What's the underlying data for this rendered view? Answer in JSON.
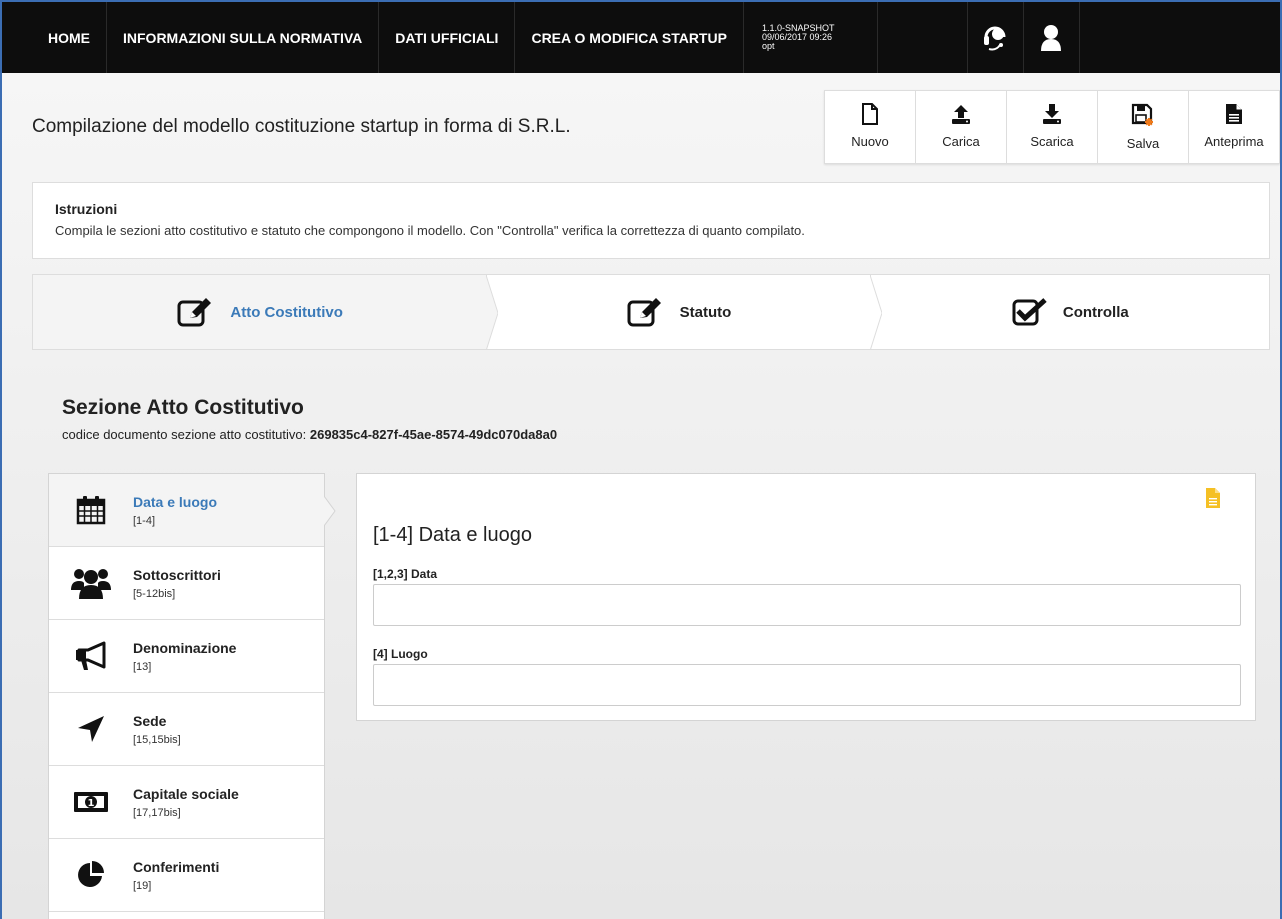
{
  "nav": {
    "items": [
      "HOME",
      "INFORMAZIONI SULLA NORMATIVA",
      "DATI UFFICIALI",
      "CREA O MODIFICA STARTUP"
    ],
    "version": [
      "1.1.0-SNAPSHOT",
      "09/06/2017 09:26",
      "opt"
    ]
  },
  "header": {
    "title": "Compilazione del modello costituzione startup in forma di S.R.L."
  },
  "toolbar": {
    "buttons": [
      {
        "label": "Nuovo",
        "icon": "new-file-icon"
      },
      {
        "label": "Carica",
        "icon": "upload-icon"
      },
      {
        "label": "Scarica",
        "icon": "download-icon"
      },
      {
        "label": "Salva",
        "icon": "save-icon"
      },
      {
        "label": "Anteprima",
        "icon": "preview-icon"
      }
    ]
  },
  "instructions": {
    "heading": "Istruzioni",
    "text": "Compila le sezioni atto costitutivo e statuto che compongono il modello. Con \"Controlla\" verifica la correttezza di quanto compilato."
  },
  "steps": [
    {
      "label": "Atto Costitutivo",
      "icon": "edit-icon",
      "active": true
    },
    {
      "label": "Statuto",
      "icon": "edit-icon",
      "active": false
    },
    {
      "label": "Controlla",
      "icon": "checkbox-icon",
      "active": false
    }
  ],
  "section": {
    "title": "Sezione Atto Costitutivo",
    "code_label": "codice documento sezione atto costitutivo:",
    "code_value": "269835c4-827f-45ae-8574-49dc070da8a0"
  },
  "sidemenu": [
    {
      "label": "Data e luogo",
      "ref": "[1-4]",
      "icon": "calendar-icon",
      "active": true
    },
    {
      "label": "Sottoscrittori",
      "ref": "[5-12bis]",
      "icon": "users-icon",
      "active": false
    },
    {
      "label": "Denominazione",
      "ref": "[13]",
      "icon": "megaphone-icon",
      "active": false
    },
    {
      "label": "Sede",
      "ref": "[15,15bis]",
      "icon": "location-arrow-icon",
      "active": false
    },
    {
      "label": "Capitale sociale",
      "ref": "[17,17bis]",
      "icon": "money-icon",
      "active": false
    },
    {
      "label": "Conferimenti",
      "ref": "[19]",
      "icon": "pie-chart-icon",
      "active": false
    }
  ],
  "form": {
    "title": "[1-4] Data e luogo",
    "fields": [
      {
        "label": "[1,2,3] Data",
        "value": "",
        "placeholder": ""
      },
      {
        "label": "[4] Luogo",
        "value": "",
        "placeholder": ""
      }
    ]
  },
  "colors": {
    "accent": "#3b7ab8",
    "navbar": "#0d0d0d",
    "doc_icon": "#f5c024",
    "frame": "#3b6db3"
  }
}
